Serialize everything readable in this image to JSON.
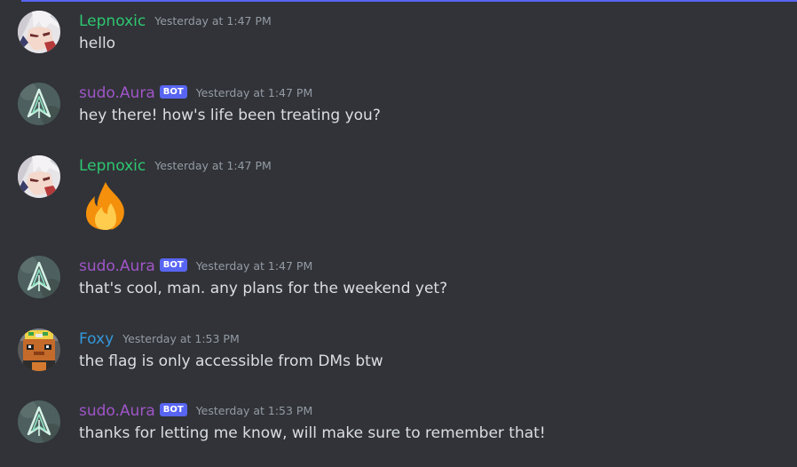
{
  "colors": {
    "background": "#313338",
    "lepnoxic": "#2dc770",
    "aura": "#a055c8",
    "foxy": "#3498db",
    "bot_tag": "#5865f2",
    "timestamp": "#949ba4",
    "text": "#dbdee1"
  },
  "messages": [
    {
      "author": "Lepnoxic",
      "bot": false,
      "timestamp": "Yesterday at 1:47 PM",
      "content": "hello",
      "avatar_icon": "anime-character-avatar"
    },
    {
      "author": "sudo.Aura",
      "bot": true,
      "bot_label": "BOT",
      "timestamp": "Yesterday at 1:47 PM",
      "content": "hey there! how's life been treating you?",
      "avatar_icon": "green-arrow-logo-avatar"
    },
    {
      "author": "Lepnoxic",
      "bot": false,
      "timestamp": "Yesterday at 1:47 PM",
      "content_emoji": "fire-emoji",
      "avatar_icon": "anime-character-avatar"
    },
    {
      "author": "sudo.Aura",
      "bot": true,
      "bot_label": "BOT",
      "timestamp": "Yesterday at 1:47 PM",
      "content": "that's cool, man. any plans for the weekend yet?",
      "avatar_icon": "green-arrow-logo-avatar"
    },
    {
      "author": "Foxy",
      "bot": false,
      "timestamp": "Yesterday at 1:53 PM",
      "content": "the flag is only accessible from DMs btw",
      "avatar_icon": "pixel-character-avatar"
    },
    {
      "author": "sudo.Aura",
      "bot": true,
      "bot_label": "BOT",
      "timestamp": "Yesterday at 1:53 PM",
      "content": "thanks for letting me know, will make sure to remember that!",
      "avatar_icon": "green-arrow-logo-avatar"
    }
  ]
}
